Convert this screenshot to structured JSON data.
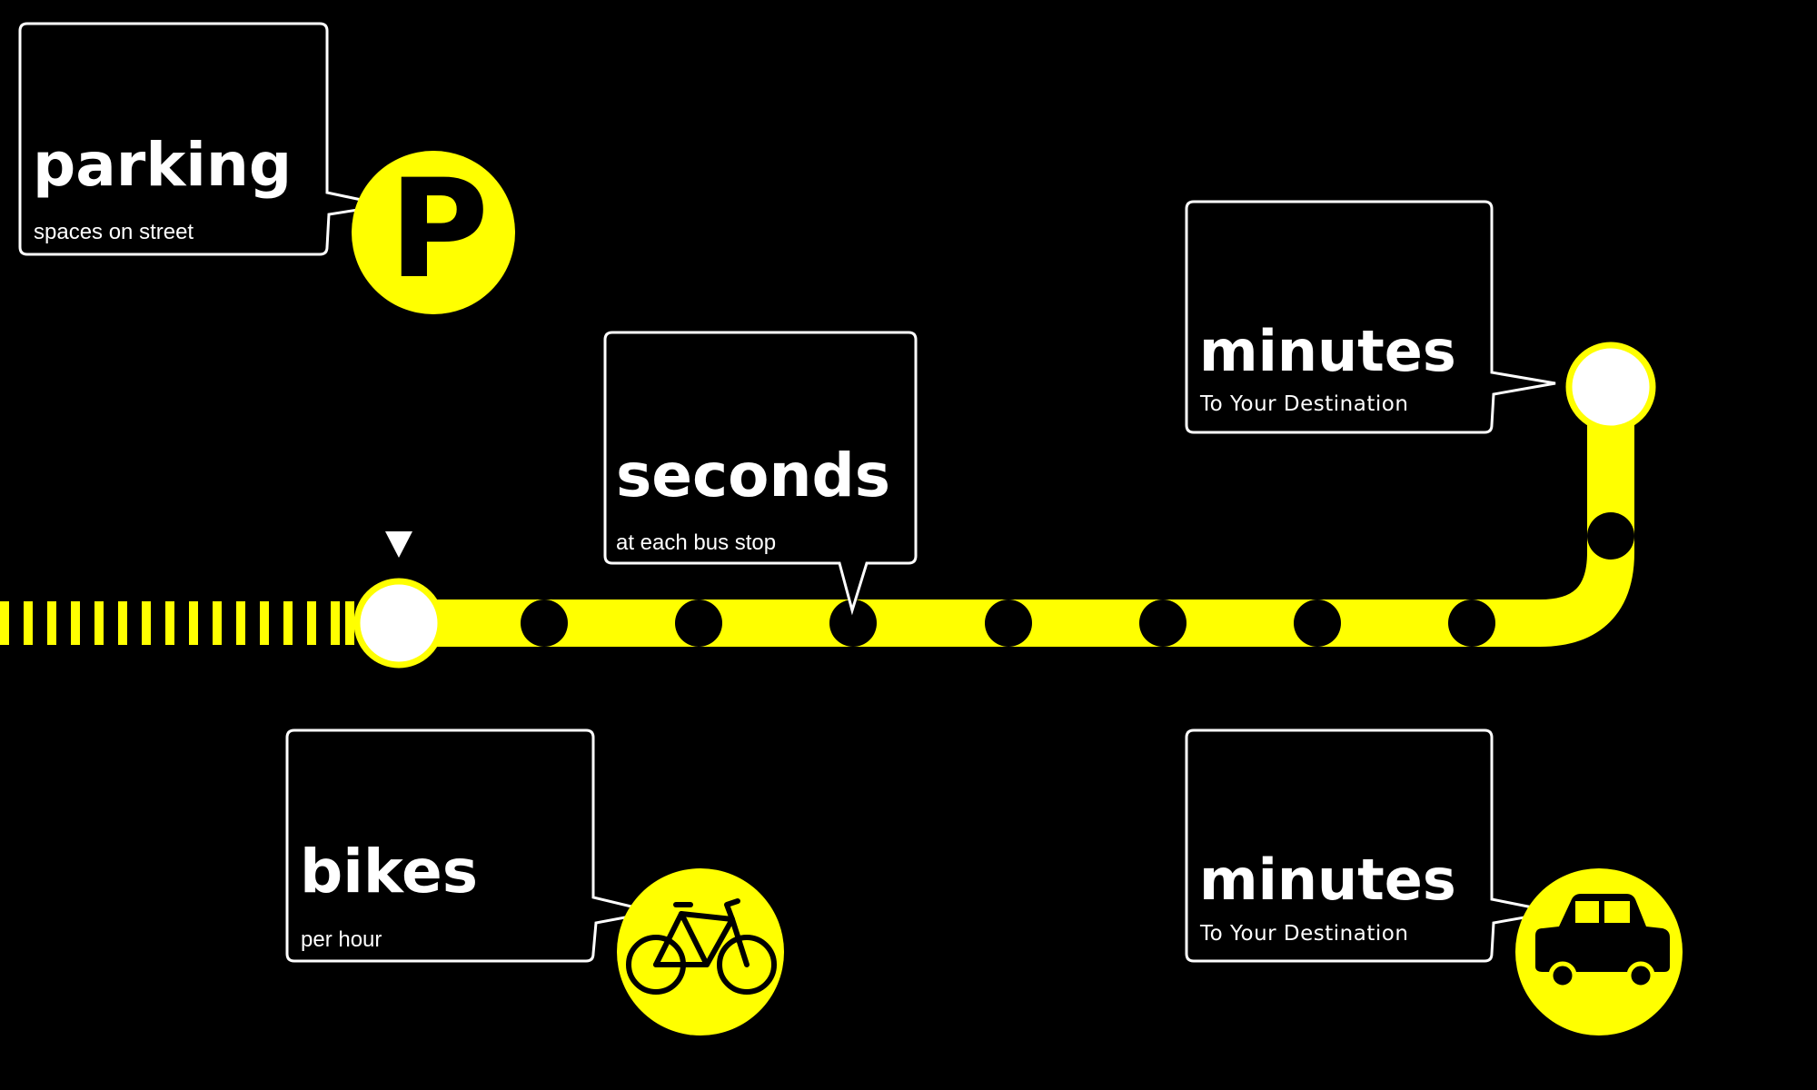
{
  "colors": {
    "background": "#000000",
    "route": "#ffff00",
    "outline": "#ffffff",
    "stop": "#000000"
  },
  "callouts": {
    "parking": {
      "title": "parking",
      "subtitle": "spaces on street",
      "icon": "parking-icon"
    },
    "seconds": {
      "title": "seconds",
      "subtitle": "at each bus stop"
    },
    "minutes_destination": {
      "title": "minutes",
      "subtitle": "To Your Destination",
      "icon": "destination-marker-icon"
    },
    "bikes": {
      "title": "bikes",
      "subtitle": "per hour",
      "icon": "bicycle-icon"
    },
    "minutes_car": {
      "title": "minutes",
      "subtitle": "To Your Destination",
      "icon": "car-icon"
    }
  },
  "parking_icon_letter": "P",
  "route": {
    "start_marker_icon": "triangle-down-icon",
    "stop_count": 8
  }
}
